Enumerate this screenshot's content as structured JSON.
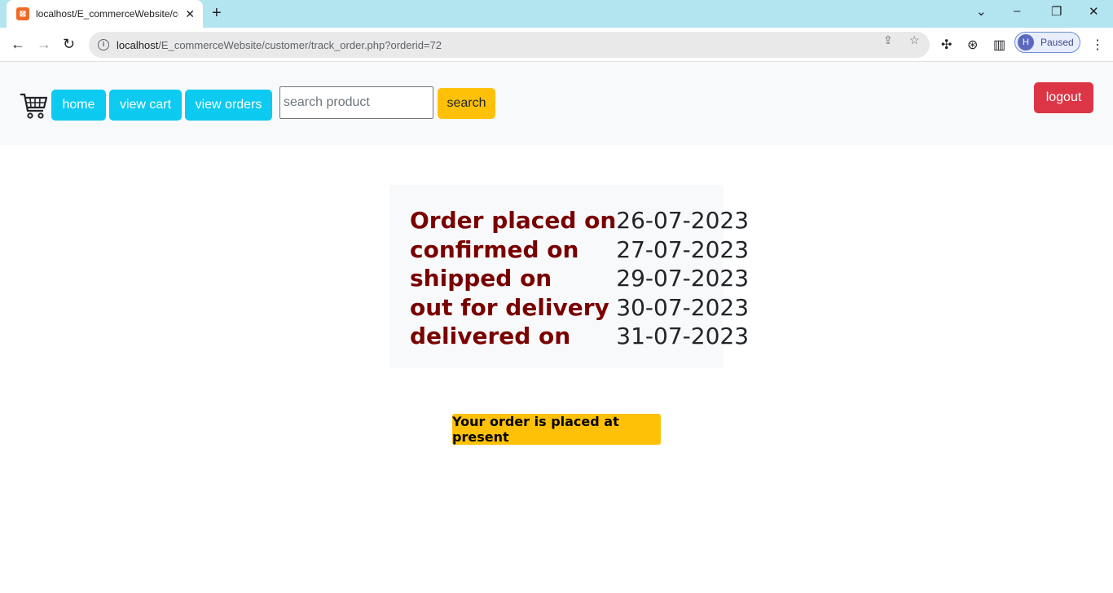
{
  "browser": {
    "tab_title": "localhost/E_commerceWebsite/cu",
    "url_host": "localhost",
    "url_path": "/E_commerceWebsite/customer/track_order.php?orderid=72",
    "profile_initial": "H",
    "profile_status": "Paused"
  },
  "nav": {
    "home": "home",
    "view_cart": "view cart",
    "view_orders": "view orders",
    "search_placeholder": "search product",
    "search_button": "search",
    "logout": "logout"
  },
  "tracking": {
    "rows": [
      {
        "label": "Order placed on",
        "date": "26-07-2023"
      },
      {
        "label": "confirmed on",
        "date": "27-07-2023"
      },
      {
        "label": "shipped on",
        "date": "29-07-2023"
      },
      {
        "label": "out for delivery",
        "date": "30-07-2023"
      },
      {
        "label": "delivered on",
        "date": "31-07-2023"
      }
    ]
  },
  "status_message": "Your order is placed at present",
  "colors": {
    "nav_pill": "#0dcaf0",
    "search_button": "#ffc107",
    "logout_button": "#dc3545",
    "label_text": "#7a0000",
    "status_badge": "#ffc107"
  }
}
